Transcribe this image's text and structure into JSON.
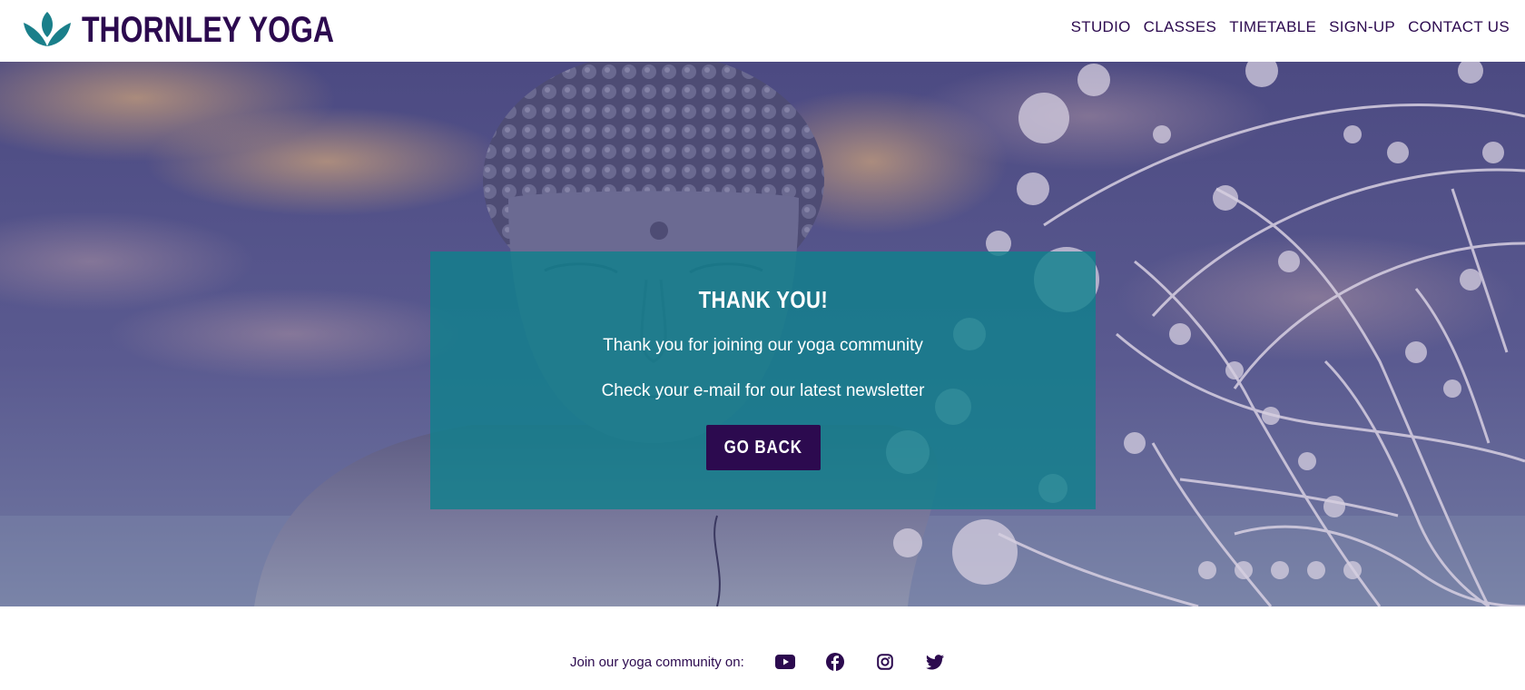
{
  "brand": {
    "name": "THORNLEY YOGA",
    "logo_icon": "lotus-icon",
    "color": "#2c0a4f",
    "accent": "#1a7f8a"
  },
  "nav": {
    "items": [
      {
        "label": "STUDIO"
      },
      {
        "label": "CLASSES"
      },
      {
        "label": "TIMETABLE"
      },
      {
        "label": "SIGN-UP"
      },
      {
        "label": "CONTACT US"
      }
    ]
  },
  "hero": {
    "background": "buddha-statue-with-mandala-image",
    "card": {
      "title": "THANK YOU!",
      "line1": "Thank you for joining our yoga community",
      "line2": "Check your e-mail for our latest newsletter",
      "button_label": "GO BACK",
      "background_color": "#10808c"
    }
  },
  "footer": {
    "text": "Join our yoga community on:",
    "social_icons": [
      "youtube-icon",
      "facebook-icon",
      "instagram-icon",
      "twitter-icon"
    ]
  }
}
